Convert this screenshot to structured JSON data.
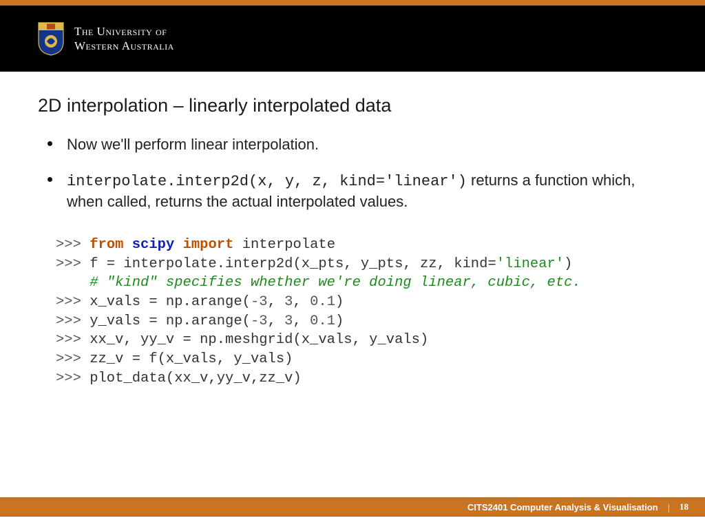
{
  "header": {
    "university_line1": "The University of",
    "university_line2": "Western Australia"
  },
  "slide": {
    "title": "2D interpolation – linearly interpolated data",
    "bullet1": "Now we'll perform linear interpolation.",
    "bullet2_code": "interpolate.interp2d(x, y, z, kind='linear')",
    "bullet2_rest": " returns a function which, when called, returns the actual interpolated values."
  },
  "code": {
    "prompt": ">>>",
    "kw_from": "from",
    "mod_scipy": "scipy",
    "kw_import": "import",
    "t_interpolate": " interpolate",
    "l2a": " f = interpolate.interp2d(x_pts, y_pts, zz, kind=",
    "l2_str": "'linear'",
    "l2b": ")",
    "comment_pad": "    ",
    "comment": "# \"kind\" specifies whether we're doing linear, cubic, etc.",
    "l4a": " x_vals = np.arange(",
    "n_m3a": "-3",
    "c": ", ",
    "n_3a": "3",
    "n_01a": "0.1",
    "paren": ")",
    "l5a": " y_vals = np.arange(",
    "n_m3b": "-3",
    "n_3b": "3",
    "n_01b": "0.1",
    "l6": " xx_v, yy_v = np.meshgrid(x_vals, y_vals)",
    "l7": " zz_v = f(x_vals, y_vals)",
    "l8": " plot_data(xx_v,yy_v,zz_v)"
  },
  "footer": {
    "course": "CITS2401 Computer Analysis & Visualisation",
    "page": "18"
  }
}
